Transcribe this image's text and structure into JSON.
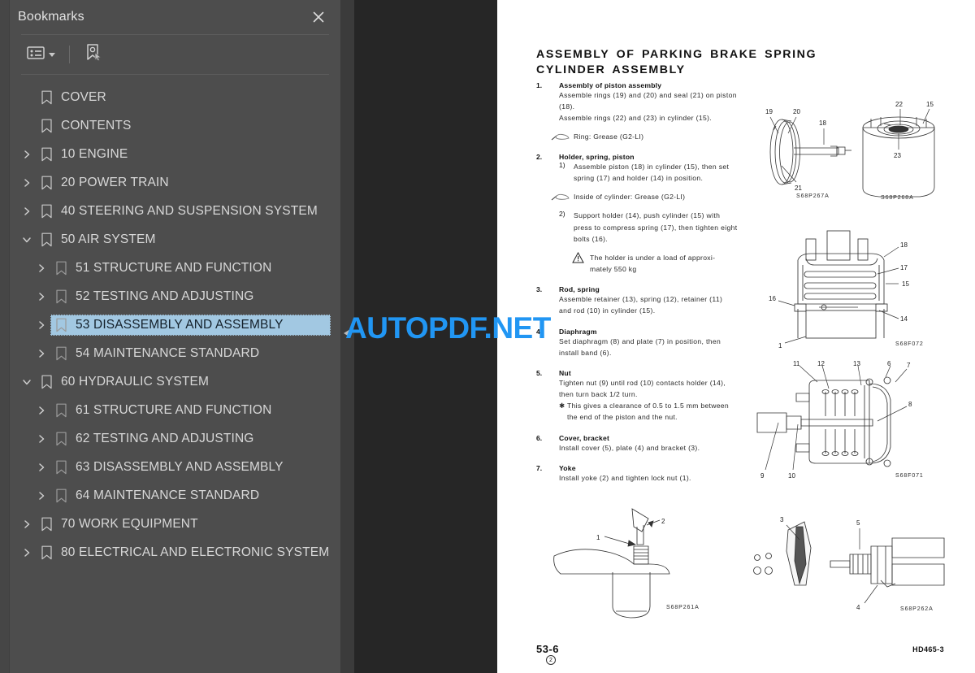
{
  "sidebar": {
    "title": "Bookmarks",
    "close_icon": "close-icon",
    "toolbar": {
      "options_icon": "list-options-icon",
      "caret_icon": "chevron-down-icon",
      "new_bookmark_icon": "bookmark-cursor-icon"
    },
    "items": [
      {
        "label": "COVER",
        "level": 1,
        "twisty": "none",
        "selected": false
      },
      {
        "label": "CONTENTS",
        "level": 1,
        "twisty": "none",
        "selected": false
      },
      {
        "label": "10 ENGINE",
        "level": 1,
        "twisty": "collapsed",
        "selected": false
      },
      {
        "label": "20 POWER TRAIN",
        "level": 1,
        "twisty": "collapsed",
        "selected": false
      },
      {
        "label": "40 STEERING AND SUSPENSION SYSTEM",
        "level": 1,
        "twisty": "collapsed",
        "selected": false
      },
      {
        "label": "50 AIR SYSTEM",
        "level": 1,
        "twisty": "expanded",
        "selected": false
      },
      {
        "label": "51 STRUCTURE AND FUNCTION",
        "level": 2,
        "twisty": "collapsed",
        "selected": false
      },
      {
        "label": "52 TESTING AND ADJUSTING",
        "level": 2,
        "twisty": "collapsed",
        "selected": false
      },
      {
        "label": "53 DISASSEMBLY AND ASSEMBLY",
        "level": 2,
        "twisty": "collapsed",
        "selected": true
      },
      {
        "label": "54 MAINTENANCE STANDARD",
        "level": 2,
        "twisty": "collapsed",
        "selected": false
      },
      {
        "label": "60 HYDRAULIC SYSTEM",
        "level": 1,
        "twisty": "expanded",
        "selected": false
      },
      {
        "label": "61 STRUCTURE AND FUNCTION",
        "level": 2,
        "twisty": "collapsed",
        "selected": false
      },
      {
        "label": "62 TESTING AND ADJUSTING",
        "level": 2,
        "twisty": "collapsed",
        "selected": false
      },
      {
        "label": "63 DISASSEMBLY AND ASSEMBLY",
        "level": 2,
        "twisty": "collapsed",
        "selected": false
      },
      {
        "label": "64 MAINTENANCE STANDARD",
        "level": 2,
        "twisty": "collapsed",
        "selected": false
      },
      {
        "label": "70 WORK EQUIPMENT",
        "level": 1,
        "twisty": "collapsed",
        "selected": false
      },
      {
        "label": "80 ELECTRICAL AND ELECTRONIC SYSTEM",
        "level": 1,
        "twisty": "collapsed",
        "selected": false
      }
    ]
  },
  "splitter": {
    "collapse_icon": "collapse-left-arrow-icon"
  },
  "watermark": {
    "text": "AUTOPDF.NET",
    "color": "#2196f3"
  },
  "page": {
    "title": "ASSEMBLY OF PARKING BRAKE SPRING CYLINDER ASSEMBLY",
    "steps": [
      {
        "num": "1.",
        "head": "Assembly of piston assembly",
        "body_lines": [
          "Assemble rings (19) and (20) and seal (21) on piston",
          "(18).",
          "Assemble rings (22) and (23) in cylinder (15)."
        ],
        "note": "Ring: Grease (G2-LI)"
      },
      {
        "num": "2.",
        "head": "Holder, spring, piston",
        "sub1_num": "1)",
        "sub1_lines": [
          "Assemble piston (18) in cylinder (15), then set",
          "spring (17) and holder (14) in position."
        ],
        "note": "Inside of cylinder: Grease (G2-LI)",
        "sub2_num": "2)",
        "sub2_lines": [
          "Support holder (14), push cylinder (15) with",
          "press to compress spring (17), then tighten eight",
          "bolts (16)."
        ],
        "warning_lines": [
          "The holder is under a load of approxi-",
          "mately 550 kg"
        ]
      },
      {
        "num": "3.",
        "head": "Rod, spring",
        "body_lines": [
          "Assemble retainer (13), spring (12), retainer (11)",
          "and rod (10) in cylinder (15)."
        ]
      },
      {
        "num": "4.",
        "head": "Diaphragm",
        "body_lines": [
          "Set diaphragm (8) and plate (7) in position, then",
          "install band (6)."
        ]
      },
      {
        "num": "5.",
        "head": "Nut",
        "body_lines": [
          "Tighten nut (9) until rod (10) contacts holder (14),",
          "then turn back 1/2 turn."
        ],
        "star_lines": [
          "This gives a clearance of 0.5 to 1.5 mm between",
          "the end of the piston and the nut."
        ]
      },
      {
        "num": "6.",
        "head": "Cover, bracket",
        "body_lines": [
          "Install cover (5), plate (4) and bracket (3)."
        ]
      },
      {
        "num": "7.",
        "head": "Yoke",
        "body_lines": [
          "Install yoke (2) and tighten lock nut (1)."
        ]
      }
    ],
    "figures": [
      {
        "code": "S68P267A",
        "callouts": [
          "19",
          "20",
          "18",
          "21"
        ]
      },
      {
        "code": "S68P268A",
        "callouts": [
          "22",
          "15",
          "23"
        ]
      },
      {
        "code": "S68F072",
        "callouts": [
          "18",
          "17",
          "15",
          "16",
          "14",
          "1"
        ]
      },
      {
        "code": "S68F071",
        "callouts": [
          "11",
          "12",
          "13",
          "6",
          "7",
          "8",
          "9",
          "10"
        ]
      },
      {
        "code": "S68P261A",
        "callouts": [
          "1",
          "2"
        ]
      },
      {
        "code": "S68P262A",
        "callouts": [
          "3",
          "4",
          "5"
        ]
      }
    ],
    "footer": {
      "page_number": "53-6",
      "revision": "2",
      "model": "HD465-3"
    }
  }
}
